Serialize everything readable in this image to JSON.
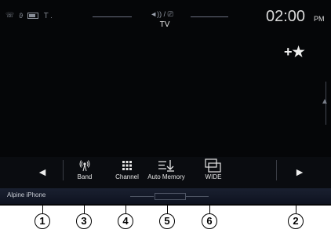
{
  "status": {
    "source_indicator": "◄)) / ⎚",
    "source_title": "TV",
    "time": "02:00",
    "ampm": "PM"
  },
  "side": {
    "favorite": "+★",
    "scroll_arrow": "▲"
  },
  "bottom": {
    "prev": "◄",
    "next": "►",
    "buttons": [
      {
        "label": "Band",
        "icon": "antenna-icon"
      },
      {
        "label": "Channel",
        "icon": "keypad-icon"
      },
      {
        "label": "Auto Memory",
        "icon": "auto-memory-icon"
      },
      {
        "label": "WIDE",
        "icon": "wide-screen-icon"
      }
    ]
  },
  "info_strip": {
    "device_name": "Alpine iPhone"
  },
  "callouts": [
    "1",
    "3",
    "4",
    "5",
    "6",
    "2"
  ]
}
